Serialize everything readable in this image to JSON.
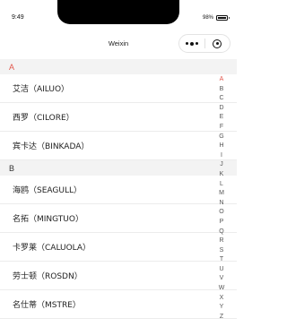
{
  "status_bar": {
    "time": "9:49",
    "battery": "98%"
  },
  "navbar": {
    "title": "Weixin"
  },
  "colors": {
    "accent": "#e2574c",
    "section_bg": "#f3f3f3"
  },
  "icons": {
    "more": "more-dots-icon",
    "close": "mini-program-close-icon",
    "battery": "battery-icon"
  },
  "sections": [
    {
      "letter": "A",
      "active": true,
      "items": [
        "艾洁（AILUO）",
        "西罗（CILORE）",
        "宾卡达（BINKADA）"
      ]
    },
    {
      "letter": "B",
      "active": false,
      "items": [
        "海鸥（SEAGULL）",
        "名拓（MINGTUO）",
        "卡罗莱（CALUOLA）",
        "劳士顿（ROSDN）",
        "名仕蒂（MSTRE）"
      ]
    }
  ],
  "index_letters": [
    "A",
    "B",
    "C",
    "D",
    "E",
    "F",
    "G",
    "H",
    "I",
    "J",
    "K",
    "L",
    "M",
    "N",
    "O",
    "P",
    "Q",
    "R",
    "S",
    "T",
    "U",
    "V",
    "W",
    "X",
    "Y",
    "Z"
  ],
  "index_active": "A"
}
